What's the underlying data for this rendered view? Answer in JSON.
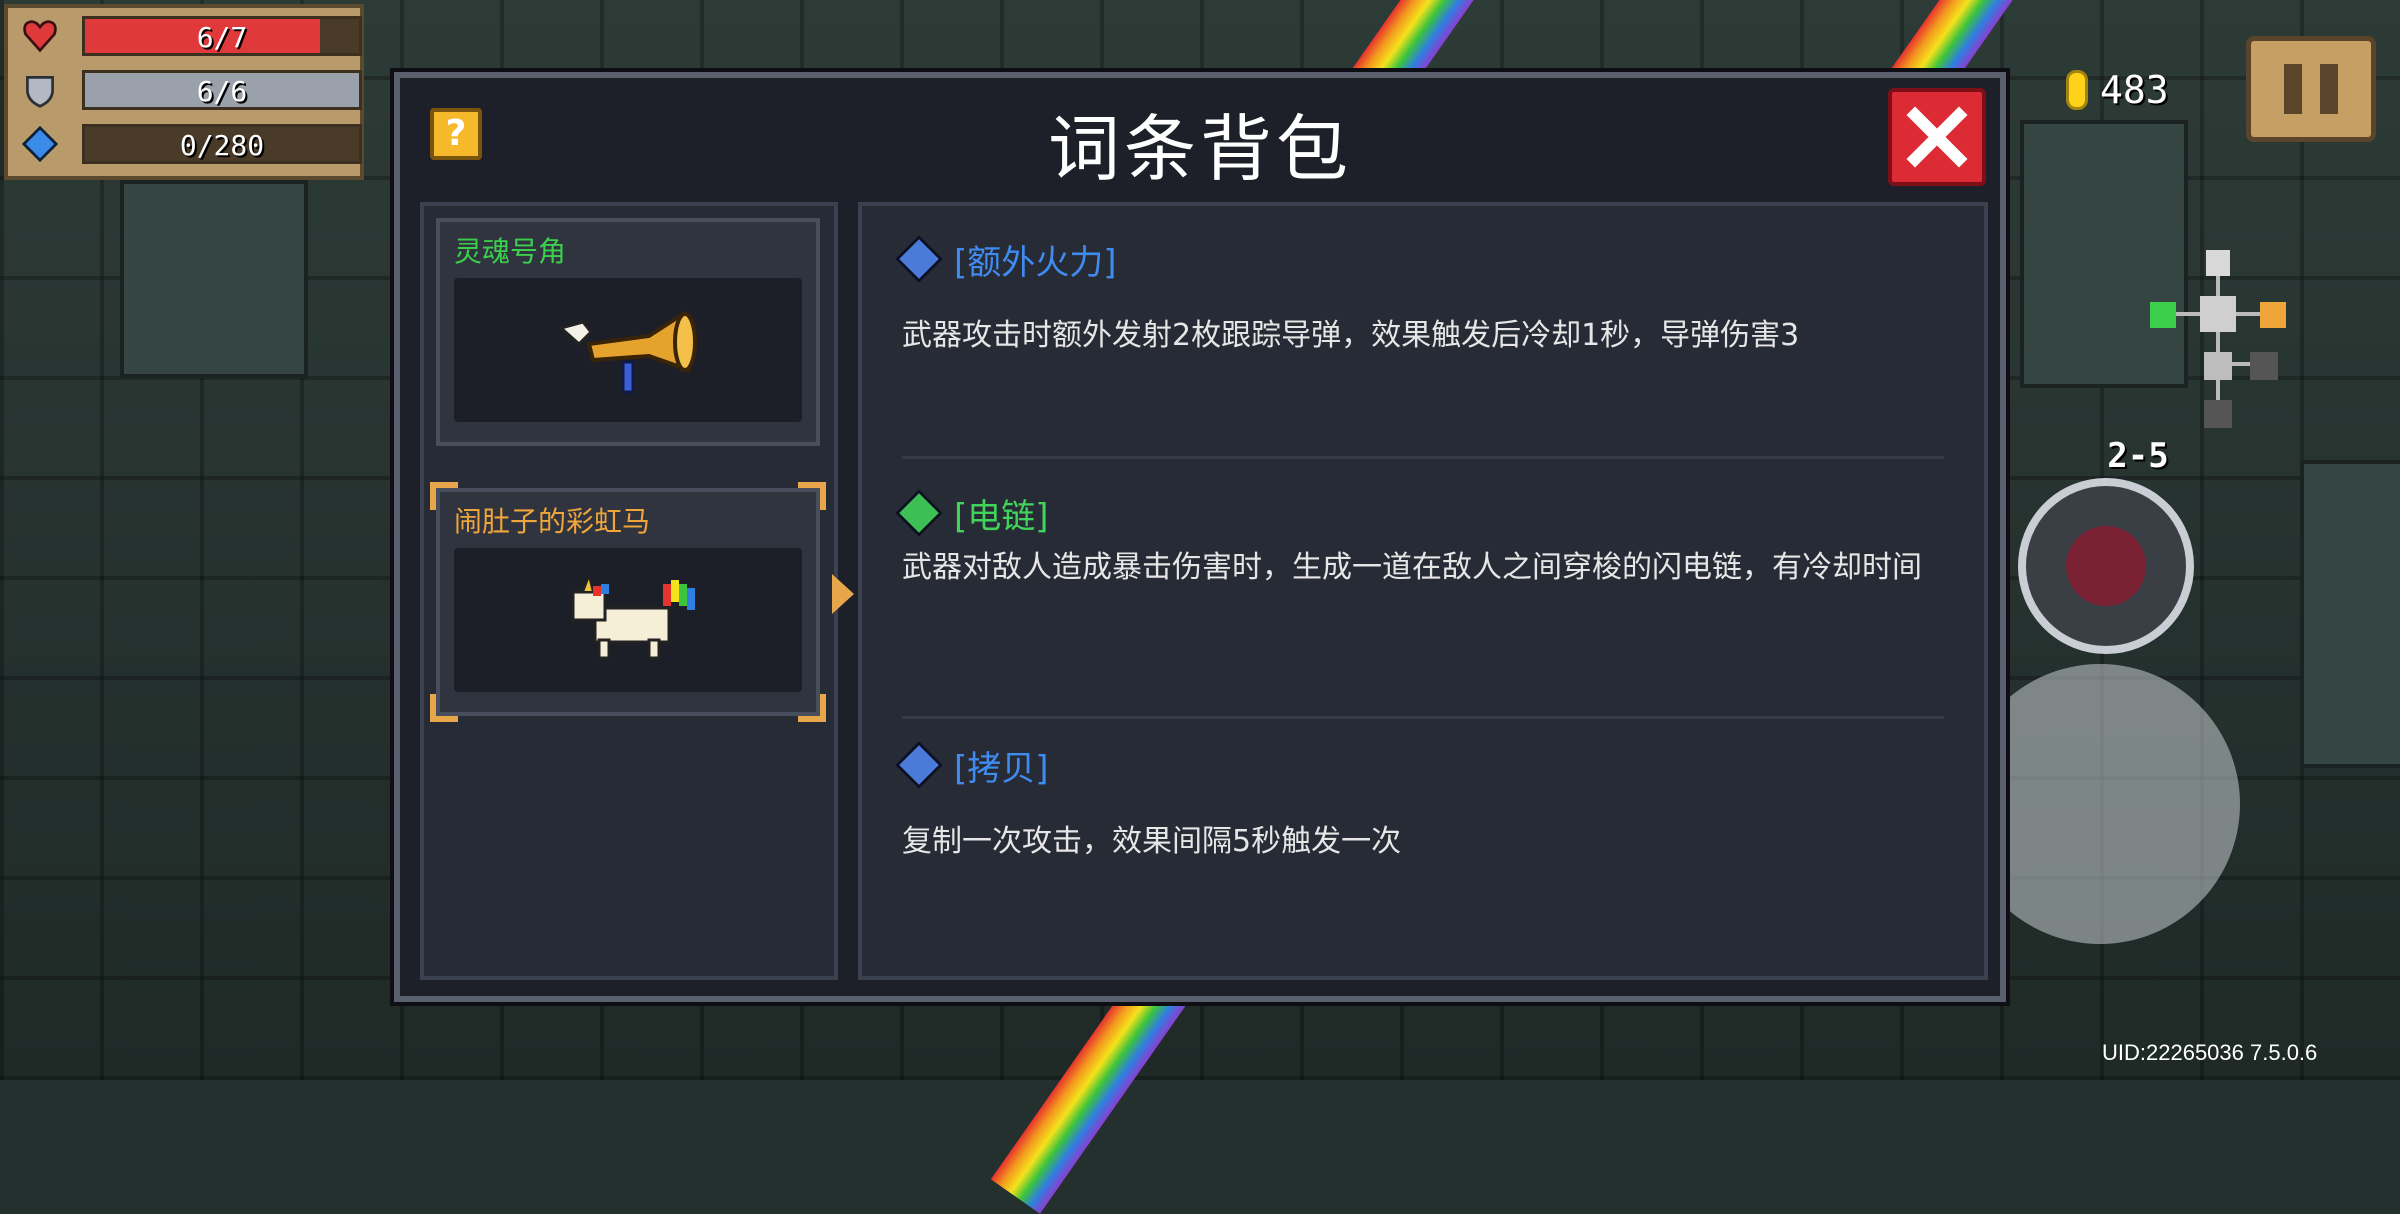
{
  "hud": {
    "hp": "6/7",
    "hp_fraction": 0.857,
    "armor": "6/6",
    "armor_fraction": 1.0,
    "energy": "0/280",
    "energy_fraction": 0,
    "coins": "483",
    "level": "2-5",
    "uid": "UID:22265036 7.5.0.6",
    "icons": {
      "hp": "heart-icon",
      "armor": "shield-icon",
      "energy": "energy-gem-icon",
      "coin": "coin-icon",
      "pause": "pause-icon"
    }
  },
  "dialog": {
    "title": "词条背包",
    "help_label": "?",
    "items": [
      {
        "name": "灵魂号角",
        "name_color": "#3ccf4e",
        "image": "soul-horn-icon",
        "selected": false
      },
      {
        "name": "闹肚子的彩虹马",
        "name_color": "#f0a53a",
        "image": "rainbow-unicorn-icon",
        "selected": true
      }
    ],
    "affixes": [
      {
        "name": "[额外火力]",
        "color": "#3f8bf0",
        "gem": "blue-gem-icon",
        "gem_color": "#4a7bd8",
        "desc": "武器攻击时额外发射2枚跟踪导弹，效果触发后冷却1秒，导弹伤害3"
      },
      {
        "name": "[电链]",
        "color": "#42d45a",
        "gem": "green-gem-icon",
        "gem_color": "#3cbf55",
        "desc": "武器对敌人造成暴击伤害时，生成一道在敌人之间穿梭的闪电链，有冷却时间"
      },
      {
        "name": "[拷贝]",
        "color": "#3f8bf0",
        "gem": "blue-gem-icon",
        "gem_color": "#4a7bd8",
        "desc": "复制一次攻击，效果间隔5秒触发一次"
      }
    ]
  },
  "colors": {
    "hp_bar": "#e0393b",
    "armor_bar": "#9aa1ab",
    "energy_bar": "#3a8ae8",
    "accent": "#e8a64a",
    "close": "#dd2b36"
  }
}
